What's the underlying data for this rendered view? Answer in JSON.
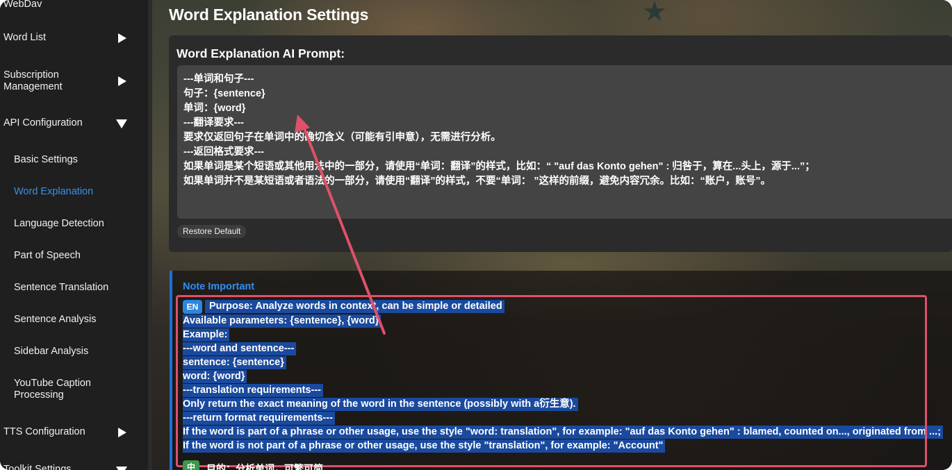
{
  "sidebar": {
    "top_partial": "WebDav",
    "items": [
      {
        "label": "Word List",
        "expanded": false
      },
      {
        "label": "Subscription Management",
        "expanded": false
      },
      {
        "label": "API Configuration",
        "expanded": true
      },
      {
        "label": "TTS Configuration",
        "expanded": false
      },
      {
        "label": "Toolkit Settings",
        "expanded": true
      }
    ],
    "sub_items": [
      {
        "label": "Basic Settings",
        "active": false
      },
      {
        "label": "Word Explanation",
        "active": true
      },
      {
        "label": "Language Detection",
        "active": false
      },
      {
        "label": "Part of Speech",
        "active": false
      },
      {
        "label": "Sentence Translation",
        "active": false
      },
      {
        "label": "Sentence Analysis",
        "active": false
      },
      {
        "label": "Sidebar Analysis",
        "active": false
      },
      {
        "label": "YouTube Caption Processing",
        "active": false
      }
    ]
  },
  "main": {
    "title": "Word Explanation Settings",
    "prompt_label": "Word Explanation AI Prompt:",
    "prompt_lines": [
      "---单词和句子---",
      "句子：{sentence}",
      "单词：{word}",
      "---翻译要求---",
      "要求仅返回句子在单词中的确切含义（可能有引申意），无需进行分析。",
      "---返回格式要求---",
      "如果单词是某个短语或其他用法中的一部分，请使用“单词：翻译”的样式，比如：“ \"auf das Konto gehen\" : 归咎于，算在...头上，源于...”；",
      "如果单词并不是某短语或者语法的一部分，请使用“翻译”的样式，不要“单词： ”这样的前缀，避免内容冗余。比如：“账户，账号”。"
    ],
    "restore_button": "Restore Default",
    "note": {
      "title": "Note Important",
      "en_badge": "EN",
      "lines": [
        "Purpose: Analyze words in context, can be simple or detailed",
        "Available parameters: {sentence}, {word}",
        "Example:",
        "---word and sentence---",
        "sentence: {sentence}",
        "word: {word}",
        "---translation requirements---",
        "Only return the exact meaning of the word in the sentence (possibly with a衍生意).",
        "---return format requirements---",
        "If the word is part of a phrase or other usage, use the style \"word: translation\", for example: \"auf das Konto gehen\" : blamed, counted on..., originated from ...;",
        "If the word is not part of a phrase or other usage, use the style \"translation\", for example: \"Account\""
      ],
      "zh_badge": "中",
      "zh_partial": "目的：分析单词，可繁可简"
    }
  },
  "colors": {
    "accent": "#2f8ef0",
    "highlight": "#1a4a9e",
    "annotation": "#e0506a"
  }
}
